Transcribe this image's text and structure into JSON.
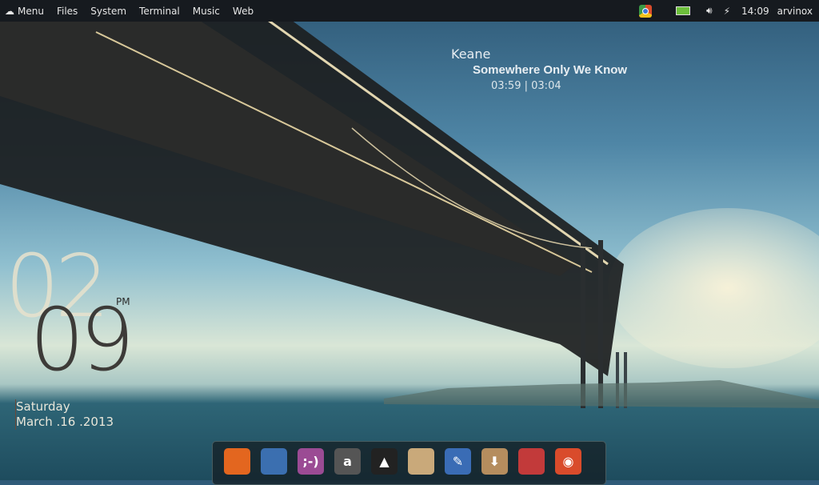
{
  "panel": {
    "menus": [
      "Menu",
      "Files",
      "System",
      "Terminal",
      "Music",
      "Web"
    ],
    "time": "14:09",
    "user": "arvinox",
    "tray_icons": [
      "chrome-icon",
      "battery-icon",
      "volume-icon",
      "network-icon"
    ]
  },
  "music": {
    "artist": "Keane",
    "title": "Somewhere Only We Know",
    "elapsed": "03:59",
    "separator": "|",
    "duration": "03:04"
  },
  "clock": {
    "hour": "02",
    "minute": "09",
    "ampm": "PM",
    "weekday": "Saturday",
    "date": "March .16 .2013"
  },
  "dock": {
    "apps": [
      {
        "name": "firefox",
        "glyph": "",
        "color": "#e3661f"
      },
      {
        "name": "thunderbird",
        "glyph": "",
        "color": "#3b6fb0"
      },
      {
        "name": "pidgin",
        "glyph": ";-)",
        "color": "#9b4b94"
      },
      {
        "name": "amarok",
        "glyph": "a",
        "color": "#555"
      },
      {
        "name": "vlc",
        "glyph": "▲",
        "color": "#222"
      },
      {
        "name": "gimp",
        "glyph": "",
        "color": "#c9a97a"
      },
      {
        "name": "inkscape",
        "glyph": "✎",
        "color": "#3a6cb5"
      },
      {
        "name": "package-installer",
        "glyph": "⬇",
        "color": "#b58d5e"
      },
      {
        "name": "ubuntu-tweak",
        "glyph": "",
        "color": "#c23a3a"
      },
      {
        "name": "chrome",
        "glyph": "◉",
        "color": "#d94b2b"
      }
    ]
  }
}
